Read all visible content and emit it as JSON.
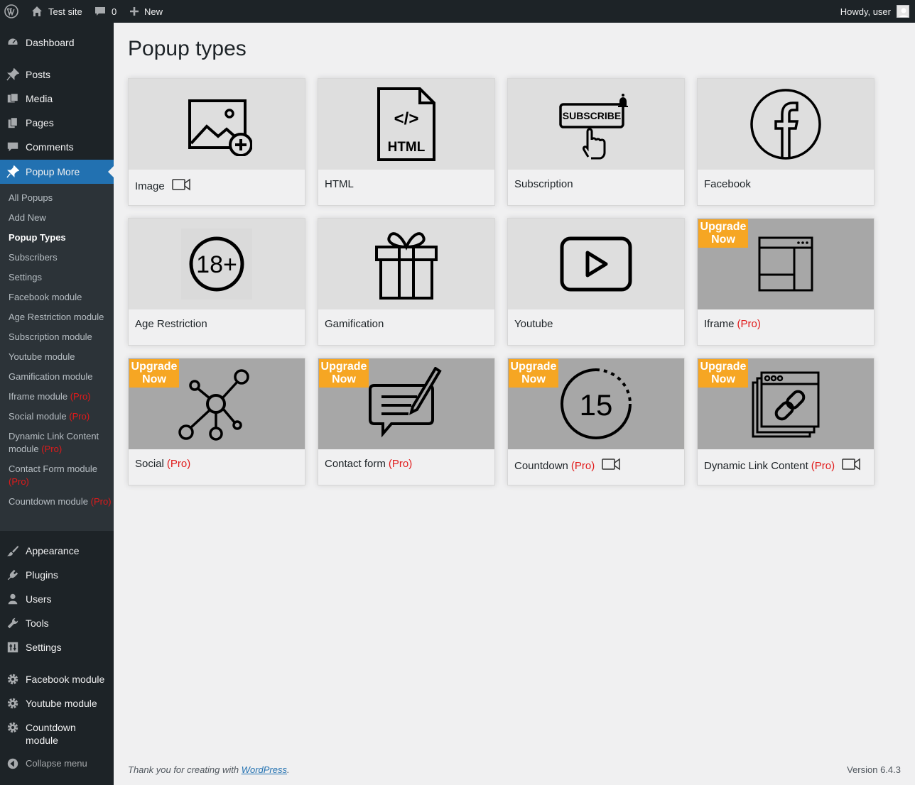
{
  "admin_bar": {
    "site_name": "Test site",
    "comments_count": "0",
    "new_label": "New",
    "howdy": "Howdy, user"
  },
  "sidebar": {
    "items_top": [
      {
        "label": "Dashboard",
        "icon": "dashboard-icon"
      },
      {
        "label": "Posts",
        "icon": "pin-icon"
      },
      {
        "label": "Media",
        "icon": "media-icon"
      },
      {
        "label": "Pages",
        "icon": "pages-icon"
      },
      {
        "label": "Comments",
        "icon": "comment-icon"
      },
      {
        "label": "Popup More",
        "icon": "pin-icon"
      }
    ],
    "submenu": [
      {
        "label": "All Popups",
        "pro": ""
      },
      {
        "label": "Add New",
        "pro": ""
      },
      {
        "label": "Popup Types",
        "pro": ""
      },
      {
        "label": "Subscribers",
        "pro": ""
      },
      {
        "label": "Settings",
        "pro": ""
      },
      {
        "label": "Facebook module",
        "pro": ""
      },
      {
        "label": "Age Restriction module",
        "pro": ""
      },
      {
        "label": "Subscription module",
        "pro": ""
      },
      {
        "label": "Youtube module",
        "pro": ""
      },
      {
        "label": "Gamification module",
        "pro": ""
      },
      {
        "label": "Iframe module",
        "pro": "(Pro)"
      },
      {
        "label": "Social module",
        "pro": "(Pro)"
      },
      {
        "label": "Dynamic Link Content module",
        "pro": "(Pro)"
      },
      {
        "label": "Contact Form module",
        "pro": "(Pro)"
      },
      {
        "label": "Countdown module",
        "pro": "(Pro)"
      }
    ],
    "items_bottom": [
      {
        "label": "Appearance",
        "icon": "brush-icon"
      },
      {
        "label": "Plugins",
        "icon": "plugin-icon"
      },
      {
        "label": "Users",
        "icon": "user-icon"
      },
      {
        "label": "Tools",
        "icon": "wrench-icon"
      },
      {
        "label": "Settings",
        "icon": "settings-icon"
      },
      {
        "label": "Facebook module",
        "icon": "gear-icon"
      },
      {
        "label": "Youtube module",
        "icon": "gear-icon"
      },
      {
        "label": "Countdown module",
        "icon": "gear-icon"
      },
      {
        "label": "Collapse menu",
        "icon": "collapse-icon"
      }
    ]
  },
  "page_title": "Popup types",
  "upgrade_label": {
    "line1": "Upgrade",
    "line2": "Now"
  },
  "cards": [
    {
      "label": "Image",
      "pro": "",
      "video": true,
      "icon": "image-add-icon"
    },
    {
      "label": "HTML",
      "pro": "",
      "video": false,
      "icon": "html-file-icon"
    },
    {
      "label": "Subscription",
      "pro": "",
      "video": false,
      "icon": "subscribe-icon"
    },
    {
      "label": "Facebook",
      "pro": "",
      "video": false,
      "icon": "facebook-icon"
    },
    {
      "label": "Age Restriction",
      "pro": "",
      "video": false,
      "icon": "age-18-icon"
    },
    {
      "label": "Gamification",
      "pro": "",
      "video": false,
      "icon": "gift-icon"
    },
    {
      "label": "Youtube",
      "pro": "",
      "video": false,
      "icon": "youtube-icon"
    },
    {
      "label": "Iframe",
      "pro": "(Pro)",
      "video": false,
      "icon": "iframe-icon"
    },
    {
      "label": "Social",
      "pro": "(Pro)",
      "video": false,
      "icon": "social-network-icon"
    },
    {
      "label": "Contact form",
      "pro": "(Pro)",
      "video": false,
      "icon": "contact-form-icon"
    },
    {
      "label": "Countdown",
      "pro": "(Pro)",
      "video": true,
      "icon": "countdown-icon"
    },
    {
      "label": "Dynamic Link Content",
      "pro": "(Pro)",
      "video": true,
      "icon": "link-content-icon"
    }
  ],
  "footer": {
    "thanks_prefix": "Thank you for creating with ",
    "wordpress_link": "WordPress",
    "thanks_suffix": ".",
    "version": "Version 6.4.3"
  },
  "colors": {
    "accent": "#2271b1",
    "upgrade_badge": "#f6a623",
    "pro_text": "#e11a1a"
  }
}
